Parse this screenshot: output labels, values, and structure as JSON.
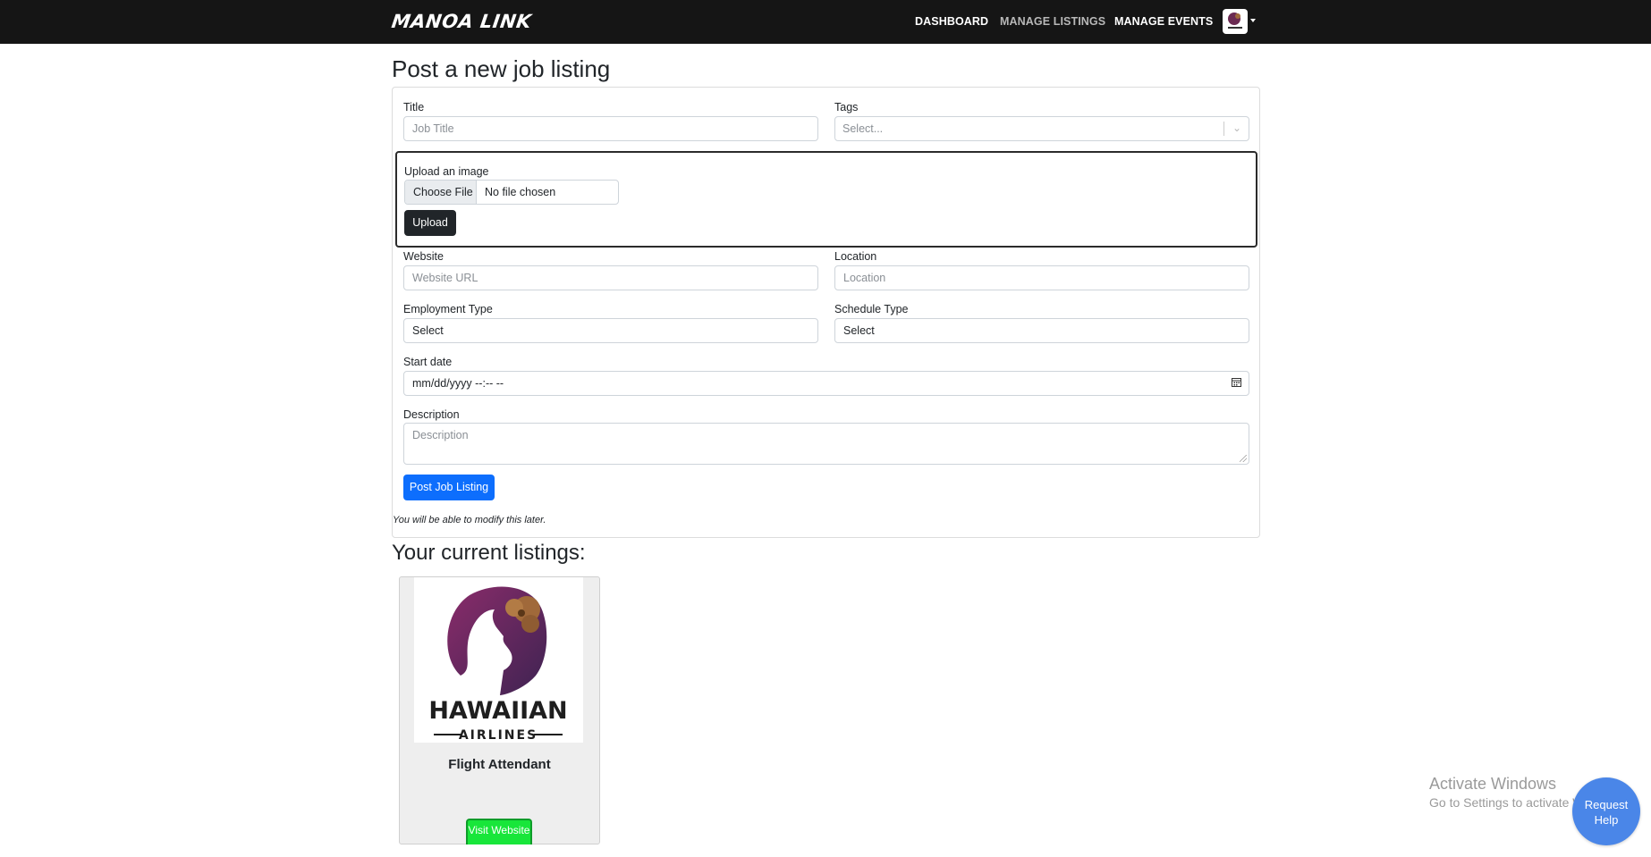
{
  "navbar": {
    "brand": "MANOA LINK",
    "links": [
      "DASHBOARD",
      "MANAGE LISTINGS",
      "MANAGE EVENTS"
    ],
    "active_link": "MANAGE LISTINGS"
  },
  "form": {
    "heading": "Post a new job listing",
    "title": {
      "label": "Title",
      "placeholder": "Job Title"
    },
    "tags": {
      "label": "Tags",
      "placeholder": "Select..."
    },
    "upload": {
      "label": "Upload an image",
      "choose_label": "Choose File",
      "file_status": "No file chosen",
      "button": "Upload"
    },
    "website": {
      "label": "Website",
      "placeholder": "Website URL"
    },
    "location": {
      "label": "Location",
      "placeholder": "Location"
    },
    "employment_type": {
      "label": "Employment Type",
      "value": "Select"
    },
    "schedule_type": {
      "label": "Schedule Type",
      "value": "Select"
    },
    "start_date": {
      "label": "Start date",
      "value": "mm/dd/yyyy --:-- --"
    },
    "description": {
      "label": "Description",
      "placeholder": "Description"
    },
    "submit": "Post Job Listing",
    "note": "You will be able to modify this later."
  },
  "listings": {
    "heading": "Your current listings:",
    "items": [
      {
        "title": "Flight Attendant",
        "logo_text": "HAWAIIAN",
        "logo_subtext": "AIRLINES",
        "button": "Visit Website"
      }
    ]
  },
  "watermark": {
    "title": "Activate Windows",
    "subtitle": "Go to Settings to activate Windows."
  },
  "help_button": {
    "line1": "Request",
    "line2": "Help"
  },
  "colors": {
    "navbar_bg": "#151515",
    "primary": "#0d6efd",
    "visit_button": "#18e63a",
    "help_bubble": "#4a86e8"
  }
}
